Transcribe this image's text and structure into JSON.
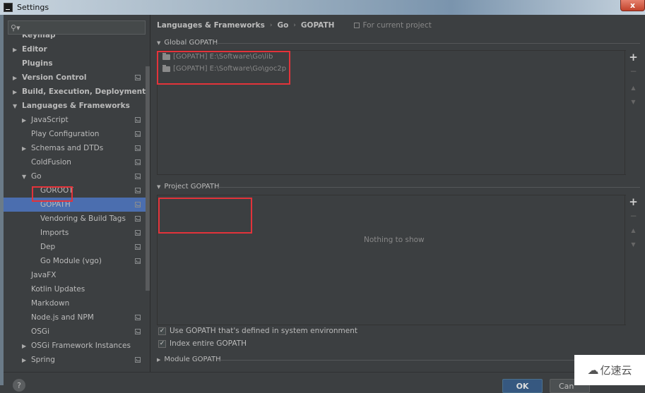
{
  "window": {
    "title": "Settings",
    "close_label": "x"
  },
  "sidebar": {
    "search": {
      "placeholder": "",
      "value": "",
      "icon": "search-icon"
    },
    "items": [
      {
        "label": "Keymap",
        "level": 0,
        "arrow": "",
        "bold": true,
        "project_icon": false
      },
      {
        "label": "Editor",
        "level": 0,
        "arrow": "▶",
        "bold": true,
        "project_icon": false
      },
      {
        "label": "Plugins",
        "level": 0,
        "arrow": "",
        "bold": true,
        "project_icon": false
      },
      {
        "label": "Version Control",
        "level": 0,
        "arrow": "▶",
        "bold": true,
        "project_icon": true
      },
      {
        "label": "Build, Execution, Deployment",
        "level": 0,
        "arrow": "▶",
        "bold": true,
        "project_icon": false
      },
      {
        "label": "Languages & Frameworks",
        "level": 0,
        "arrow": "▼",
        "bold": true,
        "project_icon": false
      },
      {
        "label": "JavaScript",
        "level": 1,
        "arrow": "▶",
        "bold": false,
        "project_icon": true
      },
      {
        "label": "Play Configuration",
        "level": 1,
        "arrow": "",
        "bold": false,
        "project_icon": true
      },
      {
        "label": "Schemas and DTDs",
        "level": 1,
        "arrow": "▶",
        "bold": false,
        "project_icon": true
      },
      {
        "label": "ColdFusion",
        "level": 1,
        "arrow": "",
        "bold": false,
        "project_icon": true
      },
      {
        "label": "Go",
        "level": 1,
        "arrow": "▼",
        "bold": false,
        "project_icon": true
      },
      {
        "label": "GOROOT",
        "level": 2,
        "arrow": "",
        "bold": false,
        "project_icon": true
      },
      {
        "label": "GOPATH",
        "level": 2,
        "arrow": "",
        "bold": false,
        "project_icon": true,
        "selected": true
      },
      {
        "label": "Vendoring & Build Tags",
        "level": 2,
        "arrow": "",
        "bold": false,
        "project_icon": true
      },
      {
        "label": "Imports",
        "level": 2,
        "arrow": "",
        "bold": false,
        "project_icon": true
      },
      {
        "label": "Dep",
        "level": 2,
        "arrow": "",
        "bold": false,
        "project_icon": true
      },
      {
        "label": "Go Module (vgo)",
        "level": 2,
        "arrow": "",
        "bold": false,
        "project_icon": true
      },
      {
        "label": "JavaFX",
        "level": 1,
        "arrow": "",
        "bold": false,
        "project_icon": false
      },
      {
        "label": "Kotlin Updates",
        "level": 1,
        "arrow": "",
        "bold": false,
        "project_icon": false
      },
      {
        "label": "Markdown",
        "level": 1,
        "arrow": "",
        "bold": false,
        "project_icon": false
      },
      {
        "label": "Node.js and NPM",
        "level": 1,
        "arrow": "",
        "bold": false,
        "project_icon": true
      },
      {
        "label": "OSGi",
        "level": 1,
        "arrow": "",
        "bold": false,
        "project_icon": true
      },
      {
        "label": "OSGi Framework Instances",
        "level": 1,
        "arrow": "▶",
        "bold": false,
        "project_icon": false
      },
      {
        "label": "Spring",
        "level": 1,
        "arrow": "▶",
        "bold": false,
        "project_icon": true
      }
    ],
    "help_label": "?"
  },
  "main": {
    "breadcrumb": [
      "Languages & Frameworks",
      "Go",
      "GOPATH"
    ],
    "breadcrumb_separator": "›",
    "scope_label": "For current project",
    "global_gopath": {
      "title": "Global GOPATH",
      "entries": [
        "[GOPATH] E:\\Software\\Go\\lib",
        "[GOPATH] E:\\Software\\Go\\goc2p"
      ]
    },
    "project_gopath": {
      "title": "Project GOPATH",
      "empty_text": "Nothing to show"
    },
    "toolbar": {
      "add": "+",
      "remove": "−",
      "up": "▲",
      "down": "▼"
    },
    "checkboxes": [
      {
        "label": "Use GOPATH that's defined in system environment",
        "checked": true
      },
      {
        "label": "Index entire GOPATH",
        "checked": true
      }
    ],
    "module_gopath": {
      "title": "Module GOPATH"
    }
  },
  "footer": {
    "ok_label": "OK",
    "cancel_label": "Can"
  },
  "watermark": {
    "text": "亿速云"
  },
  "colors": {
    "selection": "#4b6eaf",
    "highlight_box": "#e3333a",
    "background": "#3c3f41"
  }
}
